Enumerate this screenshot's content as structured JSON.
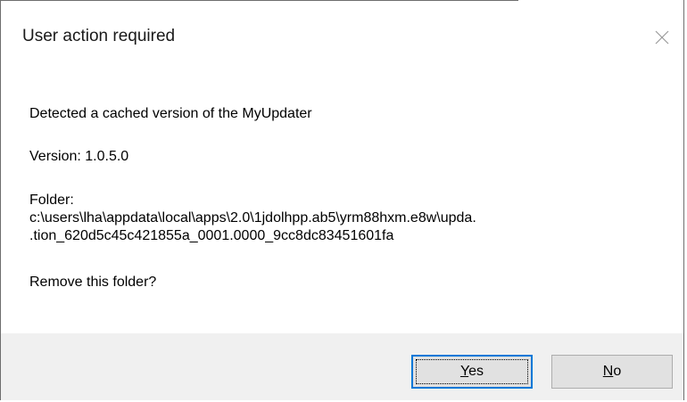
{
  "dialog": {
    "title": "User action required",
    "close_icon": "close-icon"
  },
  "message": {
    "detected": "Detected a cached version of the MyUpdater",
    "version": "Version: 1.0.5.0",
    "folder_label": "Folder:",
    "folder_path_1": "c:\\users\\lha\\appdata\\local\\apps\\2.0\\1jdolhpp.ab5\\yrm88hxm.e8w\\upda.",
    "folder_path_2": ".tion_620d5c45c421855a_0001.0000_9cc8dc83451601fa",
    "question": "Remove this folder?"
  },
  "buttons": {
    "yes_mnemonic": "Y",
    "yes_rest": "es",
    "no_mnemonic": "N",
    "no_rest": "o"
  },
  "colors": {
    "accent": "#0078d7",
    "footer_bg": "#f0f0f0",
    "button_bg": "#e1e1e1"
  }
}
